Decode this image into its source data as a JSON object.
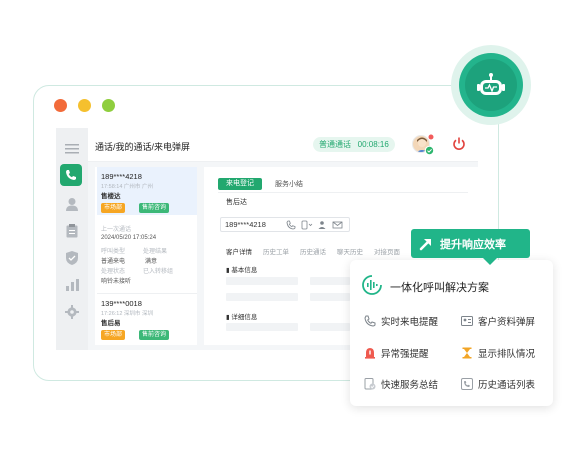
{
  "window_dots": {
    "colors": [
      "#f26b3a",
      "#f5c02e",
      "#8fce3e"
    ]
  },
  "brand": {
    "accent": "#22a86f",
    "banner_color": "#21b589"
  },
  "header": {
    "breadcrumb": "通话/我的通话/来电弹屏",
    "call_status": "普通通话",
    "timer": "00:08:16"
  },
  "sidebar": {
    "icons": [
      "menu-icon",
      "phone-icon",
      "contact-icon",
      "clipboard-icon",
      "shield-icon",
      "chart-icon",
      "settings-icon"
    ]
  },
  "calls": [
    {
      "number": "189****4218",
      "meta": "17:58:14  广州市  广州",
      "name": "售楼达",
      "tags": [
        "市场部",
        "售前咨询"
      ]
    },
    {
      "number": "139****0018",
      "meta": "17:26:12  深圳市  深圳",
      "name": "售后易",
      "tags": [
        "市场部",
        "售前咨询"
      ]
    }
  ],
  "history": {
    "heading": "上一次通话",
    "datetime": "2024/05/20  17:05:24",
    "row1_keys": [
      "呼叫类型",
      "处理结果"
    ],
    "row2_values": [
      "普通来电",
      "满意"
    ],
    "row3_keys": [
      "处理状态",
      "已入转移组"
    ],
    "row4_value": "响铃未接听"
  },
  "detail": {
    "tab_active": "来电登记",
    "tab_inactive": "服务小结",
    "company": "售后达",
    "phone": "189****4218",
    "sub_tabs": [
      "客户详情",
      "历史工单",
      "历史通话",
      "聊天历史",
      "对接页面"
    ],
    "section1": "基本信息",
    "section2": "详细信息"
  },
  "banner": {
    "label": "提升响应效率"
  },
  "features": {
    "title": "一体化呼叫解决方案",
    "items": [
      {
        "label": "实时来电提醒",
        "icon": "phone-bell-icon"
      },
      {
        "label": "客户资料弹屏",
        "icon": "id-card-icon"
      },
      {
        "label": "异常强提醒",
        "icon": "alarm-icon"
      },
      {
        "label": "显示排队情况",
        "icon": "hourglass-icon"
      },
      {
        "label": "快速服务总结",
        "icon": "doc-check-icon"
      },
      {
        "label": "历史通话列表",
        "icon": "call-history-icon"
      }
    ]
  }
}
